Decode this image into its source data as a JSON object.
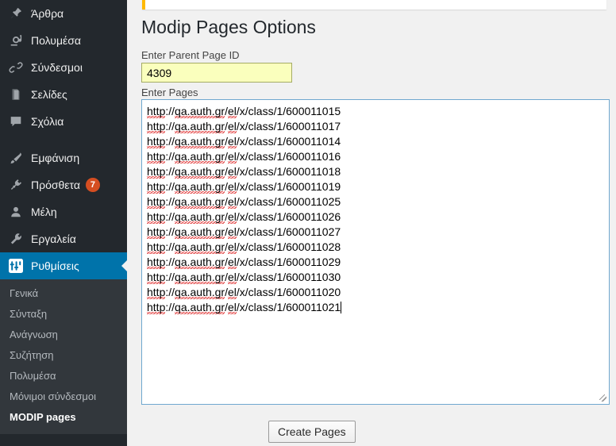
{
  "sidebar": {
    "menu": [
      {
        "label": "Άρθρα",
        "icon": "pin-icon",
        "name": "sidebar-item-posts",
        "badge": null,
        "current": false
      },
      {
        "label": "Πολυμέσα",
        "icon": "media-icon",
        "name": "sidebar-item-media",
        "badge": null,
        "current": false
      },
      {
        "label": "Σύνδεσμοι",
        "icon": "link-icon",
        "name": "sidebar-item-links",
        "badge": null,
        "current": false
      },
      {
        "label": "Σελίδες",
        "icon": "pages-icon",
        "name": "sidebar-item-pages",
        "badge": null,
        "current": false
      },
      {
        "label": "Σχόλια",
        "icon": "comment-icon",
        "name": "sidebar-item-comments",
        "badge": null,
        "current": false
      },
      {
        "label": "Εμφάνιση",
        "icon": "appearance-icon",
        "name": "sidebar-item-appearance",
        "badge": null,
        "current": false
      },
      {
        "label": "Πρόσθετα",
        "icon": "plugins-icon",
        "name": "sidebar-item-plugins",
        "badge": "7",
        "current": false
      },
      {
        "label": "Μέλη",
        "icon": "users-icon",
        "name": "sidebar-item-users",
        "badge": null,
        "current": false
      },
      {
        "label": "Εργαλεία",
        "icon": "tools-icon",
        "name": "sidebar-item-tools",
        "badge": null,
        "current": false
      },
      {
        "label": "Ρυθμίσεις",
        "icon": "settings-icon",
        "name": "sidebar-item-settings",
        "badge": null,
        "current": true
      }
    ],
    "submenu": [
      {
        "label": "Γενικά",
        "name": "submenu-item-general",
        "current": false
      },
      {
        "label": "Σύνταξη",
        "name": "submenu-item-writing",
        "current": false
      },
      {
        "label": "Ανάγνωση",
        "name": "submenu-item-reading",
        "current": false
      },
      {
        "label": "Συζήτηση",
        "name": "submenu-item-discussion",
        "current": false
      },
      {
        "label": "Πολυμέσα",
        "name": "submenu-item-media",
        "current": false
      },
      {
        "label": "Μόνιμοι σύνδεσμοι",
        "name": "submenu-item-permalinks",
        "current": false
      },
      {
        "label": "MODIP pages",
        "name": "submenu-item-modip-pages",
        "current": true
      }
    ]
  },
  "main": {
    "page_title": "Modip Pages Options",
    "parent_field": {
      "label": "Enter Parent Page ID",
      "value": "4309"
    },
    "pages_field": {
      "label": "Enter Pages",
      "lines": [
        "http://qa.auth.gr/el/x/class/1/600011015",
        "http://qa.auth.gr/el/x/class/1/600011017",
        "http://qa.auth.gr/el/x/class/1/600011014",
        "http://qa.auth.gr/el/x/class/1/600011016",
        "http://qa.auth.gr/el/x/class/1/600011018",
        "http://qa.auth.gr/el/x/class/1/600011019",
        "http://qa.auth.gr/el/x/class/1/600011025",
        "http://qa.auth.gr/el/x/class/1/600011026",
        "http://qa.auth.gr/el/x/class/1/600011027",
        "http://qa.auth.gr/el/x/class/1/600011028",
        "http://qa.auth.gr/el/x/class/1/600011029",
        "http://qa.auth.gr/el/x/class/1/600011030",
        "http://qa.auth.gr/el/x/class/1/600011020",
        "http://qa.auth.gr/el/x/class/1/600011021"
      ]
    },
    "submit_label": "Create Pages"
  },
  "colors": {
    "sidebar_bg": "#23282d",
    "submenu_bg": "#32373c",
    "accent": "#0073aa",
    "badge": "#d54e21",
    "notice_border": "#ffb900",
    "autofill": "#faffbd",
    "content_bg": "#f1f1f1"
  }
}
